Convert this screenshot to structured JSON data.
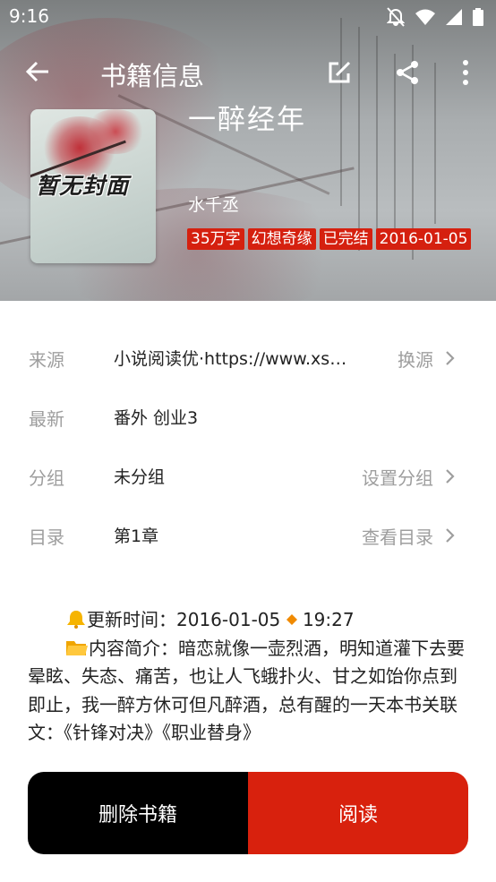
{
  "status_bar": {
    "time": "9:16"
  },
  "toolbar": {
    "title": "书籍信息"
  },
  "cover": {
    "text": "暂无封面"
  },
  "book": {
    "name": "一醉经年",
    "author": "水千丞",
    "tags": [
      "35万字",
      "幻想奇缘",
      "已完结",
      "2016-01-05"
    ]
  },
  "info": {
    "source": {
      "label": "来源",
      "value": "小说阅读优·https://www.xs…",
      "action": "换源"
    },
    "latest": {
      "label": "最新",
      "value": "番外 创业3"
    },
    "group": {
      "label": "分组",
      "value": "未分组",
      "action": "设置分组"
    },
    "toc": {
      "label": "目录",
      "value": "第1章",
      "action": "查看目录"
    }
  },
  "description": {
    "update_label": "更新时间：2016-01-05",
    "update_time": "19:27",
    "intro": "内容简介：暗恋就像一壶烈酒，明知道灌下去要晕眩、失态、痛苦，也让人飞蛾扑火、甘之如饴你点到即止，我一醉方休可但凡醉酒，总有醒的一天本书关联文：《针锋对决》《职业替身》"
  },
  "buttons": {
    "delete": "删除书籍",
    "read": "阅读"
  },
  "colors": {
    "accent": "#d8210d",
    "tag": "#d5200f",
    "delete_bg": "#000000"
  }
}
